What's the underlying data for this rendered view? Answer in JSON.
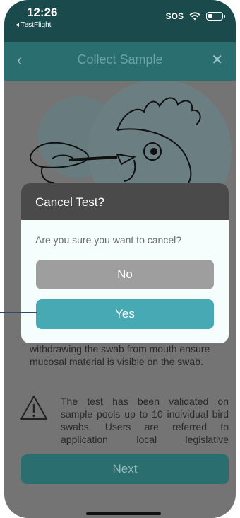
{
  "status_bar": {
    "time": "12:26",
    "back_app": "◂ TestFlight",
    "sos": "SOS"
  },
  "nav": {
    "back_icon": "‹",
    "title": "Collect Sample",
    "close_icon": "✕"
  },
  "content": {
    "body_text": "withdrawing the swab from mouth ensure mucosal material is visible on the swab.",
    "warning_text": "The test has been validated on sample pools up to 10 individual bird swabs. Users are referred to application local legislative requirements that may define",
    "next_label": "Next"
  },
  "dialog": {
    "title": "Cancel Test?",
    "message": "Are you sure you want to cancel?",
    "no_label": "No",
    "yes_label": "Yes"
  },
  "colors": {
    "accent_teal": "#47a9b3",
    "header_dark": "#2a6e70",
    "overlay_gray": "#747474"
  },
  "icons": [
    "back-chevron-icon",
    "close-icon",
    "wifi-icon",
    "battery-icon",
    "warning-icon"
  ]
}
